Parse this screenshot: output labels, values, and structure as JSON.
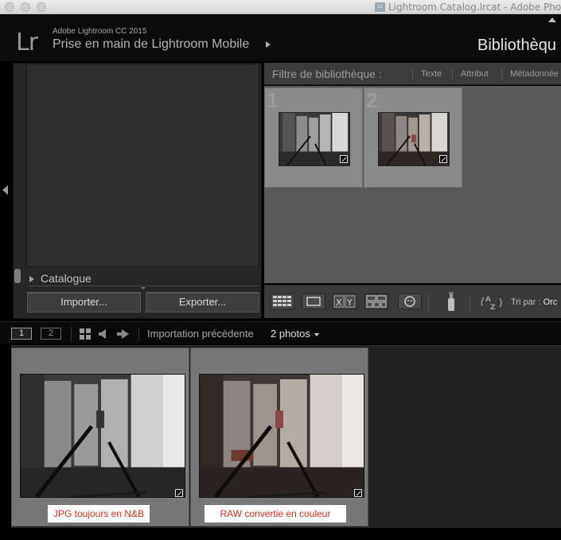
{
  "window": {
    "title": "Lightroom Catalog.lrcat - Adobe Pho",
    "app_icon_label": "Lr"
  },
  "identity": {
    "logo": "Lr",
    "version": "Adobe Lightroom CC 2015",
    "catalog_name": "Prise en main de Lightroom Mobile",
    "module": "Bibliothèqu"
  },
  "left_panel": {
    "catalogue_label": "Catalogue",
    "import_label": "Importer...",
    "export_label": "Exporter..."
  },
  "filter_bar": {
    "label": "Filtre de bibliothèque :",
    "items": [
      "Texte",
      "Attribut",
      "Métadonnée"
    ]
  },
  "grid": {
    "cells": [
      {
        "index": "1",
        "type": "bw"
      },
      {
        "index": "2",
        "type": "color"
      }
    ]
  },
  "toolbar": {
    "sort_label": "Tri par :",
    "sort_value": "Orc",
    "sort_az": "A Z"
  },
  "filmstrip_header": {
    "screen1": "1",
    "screen2": "2",
    "source": "Importation précédente",
    "count": "2 photos"
  },
  "filmstrip": {
    "items": [
      {
        "caption": "JPG toujours en N&B",
        "type": "bw"
      },
      {
        "caption": "RAW convertie en couleur",
        "type": "color"
      }
    ]
  },
  "colors": {
    "caption_text": "#e0301e",
    "caption_bg": "#ffffff"
  }
}
